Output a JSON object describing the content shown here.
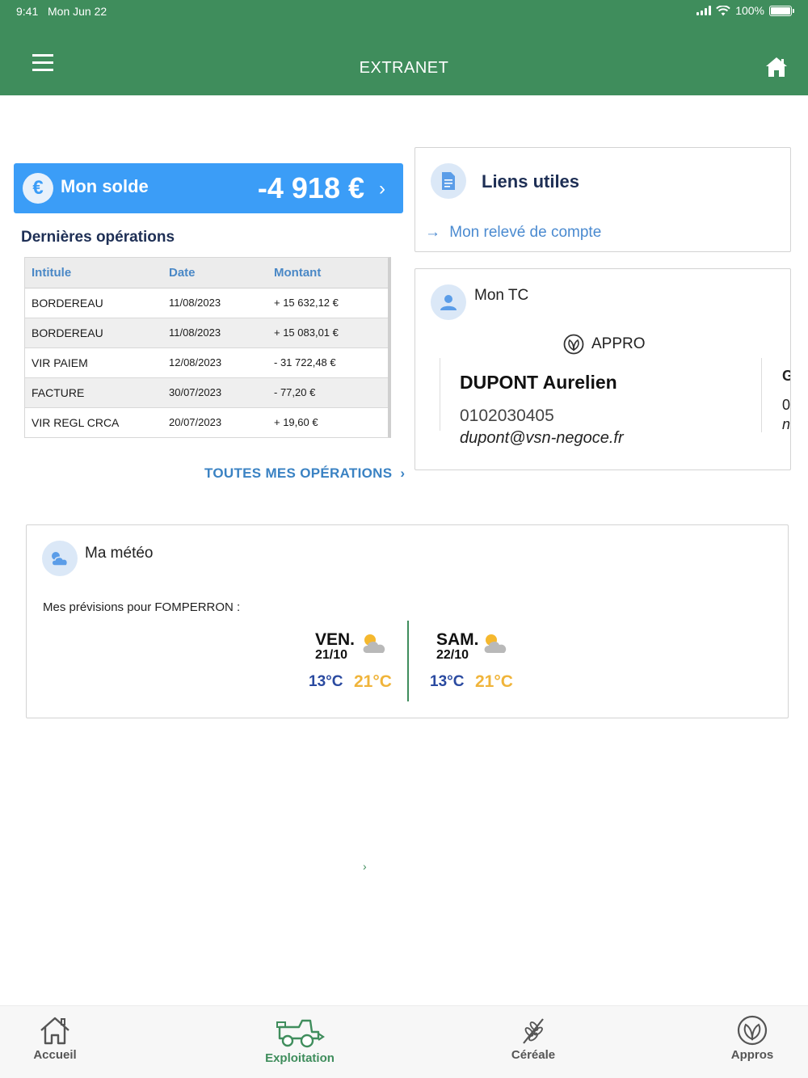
{
  "status": {
    "time": "9:41",
    "date": "Mon Jun 22",
    "battery": "100%"
  },
  "nav": {
    "title": "EXTRANET"
  },
  "balance": {
    "label": "Mon solde",
    "amount": "-4 918 €"
  },
  "operations": {
    "title": "Dernières opérations",
    "headers": {
      "label": "Intitule",
      "date": "Date",
      "amount": "Montant"
    },
    "rows": [
      {
        "label": "BORDEREAU",
        "date": "11/08/2023",
        "amount": "+ 15 632,12 €"
      },
      {
        "label": "BORDEREAU",
        "date": "11/08/2023",
        "amount": "+ 15 083,01 €"
      },
      {
        "label": "VIR PAIEM",
        "date": "12/08/2023",
        "amount": "- 31 722,48 €"
      },
      {
        "label": "FACTURE",
        "date": "30/07/2023",
        "amount": "- 77,20 €"
      },
      {
        "label": "VIR REGL CRCA",
        "date": "20/07/2023",
        "amount": "+ 19,60 €"
      }
    ],
    "all_link": "TOUTES MES OPÉRATIONS"
  },
  "links": {
    "title": "Liens utiles",
    "releve": "Mon relevé de compte"
  },
  "tc": {
    "title": "Mon TC",
    "category": "APPRO",
    "name": "DUPONT Aurelien",
    "phone": "0102030405",
    "email": "dupont@vsn-negoce.fr",
    "next_peek": [
      "G",
      "0",
      "n"
    ]
  },
  "meteo": {
    "title": "Ma météo",
    "subtitle": "Mes prévisions pour FOMPERRON :",
    "days": [
      {
        "name": "VEN.",
        "date": "21/10",
        "min": "13°C",
        "max": "21°C",
        "icon": "partly-cloudy-icon"
      },
      {
        "name": "SAM.",
        "date": "22/10",
        "min": "13°C",
        "max": "21°C",
        "icon": "partly-cloudy-icon"
      }
    ]
  },
  "tabs": [
    {
      "label": "Accueil",
      "icon": "house-icon",
      "active": false
    },
    {
      "label": "Exploitation",
      "icon": "harvester-icon",
      "active": true
    },
    {
      "label": "Céréale",
      "icon": "wheat-icon",
      "active": false
    },
    {
      "label": "Appros",
      "icon": "leaf-icon",
      "active": false
    }
  ],
  "colors": {
    "brand_green": "#3f8d5c",
    "balance_blue": "#3b9df7",
    "link_blue": "#4a8ad0",
    "temp_min": "#2a4aa0",
    "temp_max": "#f0b43a"
  }
}
